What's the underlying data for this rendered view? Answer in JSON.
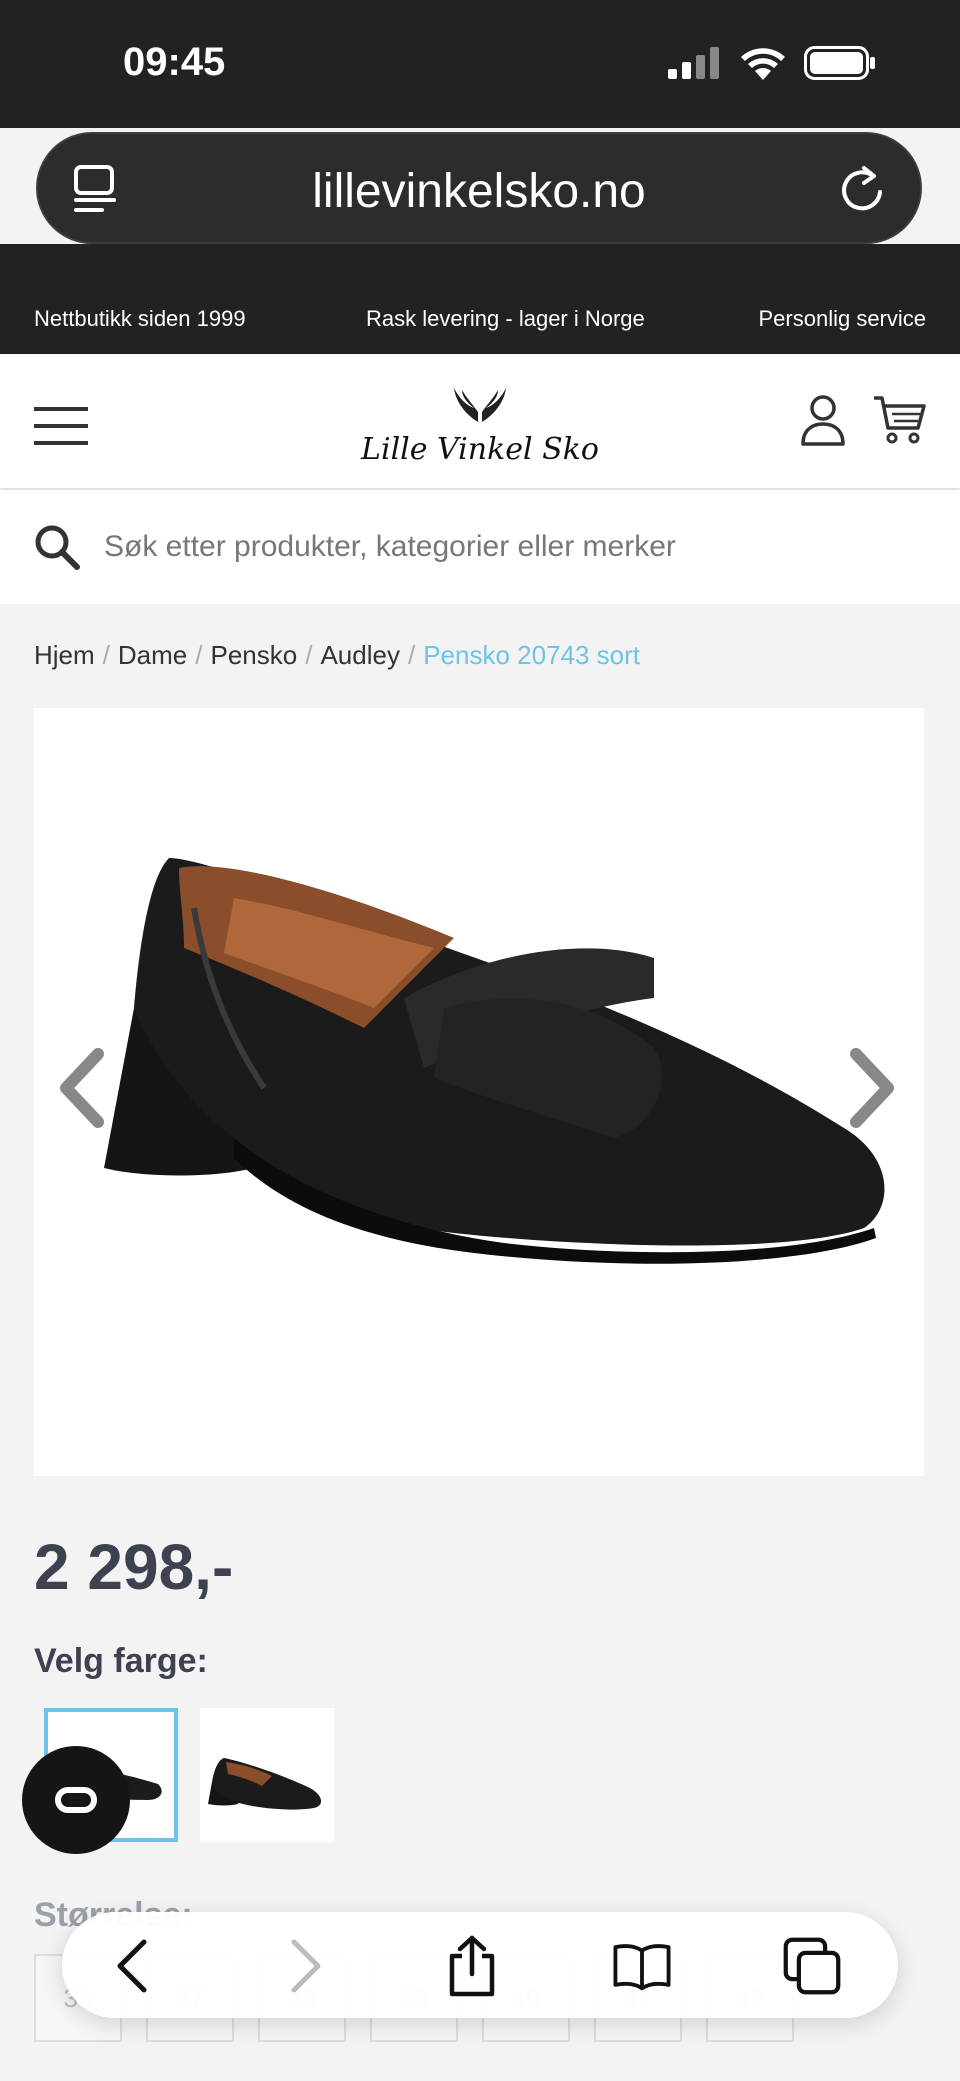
{
  "status": {
    "time": "09:45"
  },
  "browser": {
    "url": "lillevinkelsko.no"
  },
  "topbar": {
    "left": "Nettbutikk siden 1999",
    "center": "Rask levering - lager i Norge",
    "right": "Personlig service"
  },
  "header": {
    "logo_text": "Lille Vinkel Sko"
  },
  "search": {
    "placeholder": "Søk etter produkter, kategorier eller merker"
  },
  "breadcrumb": [
    {
      "label": "Hjem"
    },
    {
      "label": "Dame"
    },
    {
      "label": "Pensko"
    },
    {
      "label": "Audley"
    },
    {
      "label": "Pensko 20743 sort"
    }
  ],
  "product": {
    "price": "2 298,-",
    "color_label": "Velg farge:",
    "size_label": "Størrelse:",
    "sizes": [
      "36",
      "37",
      "38",
      "39",
      "40",
      "41",
      "42"
    ]
  },
  "colors": {
    "accent": "#6ec3e6",
    "dark": "#222222",
    "price_text": "#3e4150"
  },
  "icons": [
    "tabs-view-icon",
    "reload-icon",
    "menu-icon",
    "user-icon",
    "cart-icon",
    "search-icon",
    "chevron-left-icon",
    "chevron-right-icon",
    "share-icon",
    "bookmarks-icon",
    "tabs-icon",
    "cobrowse-icon"
  ]
}
